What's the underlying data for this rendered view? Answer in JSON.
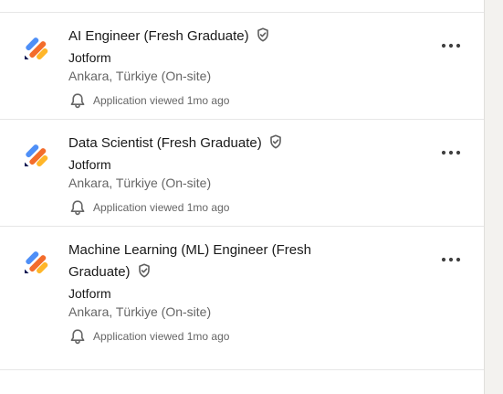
{
  "jobs": [
    {
      "title": "AI Engineer (Fresh Graduate)",
      "company": "Jotform",
      "location": "Ankara, Türkiye (On-site)",
      "status": "Application viewed 1mo ago"
    },
    {
      "title": "Data Scientist (Fresh Graduate)",
      "company": "Jotform",
      "location": "Ankara, Türkiye (On-site)",
      "status": "Application viewed 1mo ago"
    },
    {
      "title_line1": "Machine Learning (ML) Engineer (Fresh",
      "title_line2": "Graduate)",
      "company": "Jotform",
      "location": "Ankara, Türkiye (On-site)",
      "status": "Application viewed 1mo ago"
    }
  ],
  "icons": {
    "verified": "verified-shield-icon",
    "bell": "bell-icon",
    "menu": "more-actions-icon",
    "logo": "jotform-logo"
  },
  "colors": {
    "logo_blue": "#4e8ff7",
    "logo_orange": "#f36c2b",
    "logo_yellow": "#ffb629",
    "logo_dark": "#0a1551",
    "text_primary": "#191919",
    "text_secondary": "#666666",
    "divider": "#e6e6e6"
  }
}
